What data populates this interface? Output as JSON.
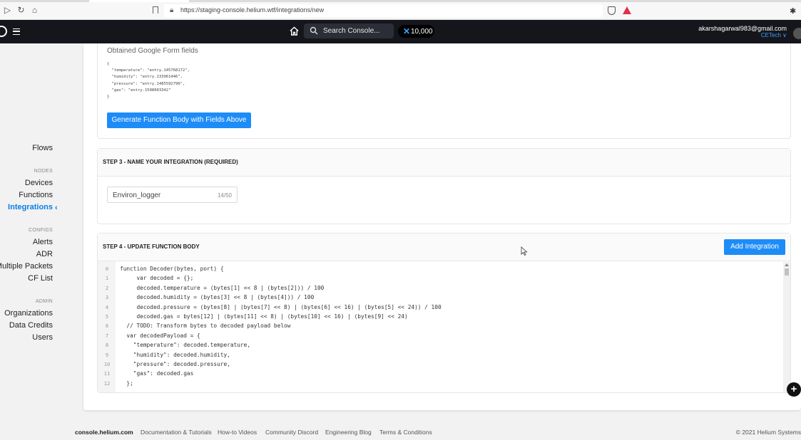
{
  "browser": {
    "url": "https://staging-console.helium.wtf/integrations/new"
  },
  "header": {
    "search_placeholder": "Search Console...",
    "dc_balance": "10,000",
    "user_email": "akarshagarwal983@gmail.com",
    "org_name": "CETech ∨"
  },
  "sidebar": {
    "flows": "Flows",
    "nodes_section": "NODES",
    "devices": "Devices",
    "functions": "Functions",
    "integrations": "Integrations",
    "configs_section": "CONFIGS",
    "alerts": "Alerts",
    "adr": "ADR",
    "multiple_packets": "Multiple Packets",
    "cf_list": "CF List",
    "admin_section": "ADMIN",
    "organizations": "Organizations",
    "data_credits": "Data Credits",
    "users": "Users"
  },
  "form_fields": {
    "title": "Obtained Google Form fields",
    "json": "{\n  \"temperature\": \"entry.145768172\",\n  \"humidity\": \"entry.133961446\",\n  \"pressure\": \"entry.1485592796\",\n  \"gas\": \"entry.1508003342\"\n}",
    "generate_button": "Generate Function Body with Fields Above"
  },
  "step3": {
    "title": "STEP 3 - NAME YOUR INTEGRATION (REQUIRED)",
    "name_value": "Environ_logger",
    "char_count": "14/50"
  },
  "step4": {
    "title": "STEP 4 - UPDATE FUNCTION BODY",
    "add_button": "Add Integration",
    "line_numbers": [
      "0",
      "1",
      "2",
      "3",
      "4",
      "5",
      "6",
      "7",
      "8",
      "9",
      "10",
      "11",
      "12"
    ],
    "code": [
      "function Decoder(bytes, port) {",
      "     var decoded = {};",
      "     decoded.temperature = (bytes[1] << 8 | (bytes[2])) / 100",
      "     decoded.humidity = (bytes[3] << 8 | (bytes[4])) / 100",
      "     decoded.pressure = (bytes[8] | (bytes[7] << 8) | (bytes[6] << 16) | (bytes[5] << 24)) / 100",
      "     decoded.gas = bytes[12] | (bytes[11] << 8) | (bytes[10] << 16) | (bytes[9] << 24)",
      "  // TODO: Transform bytes to decoded payload below",
      "  var decodedPayload = {",
      "    \"temperature\": decoded.temperature,",
      "    \"humidity\": decoded.humidity,",
      "    \"pressure\": decoded.pressure,",
      "    \"gas\": decoded.gas",
      "  };"
    ]
  },
  "footer": {
    "brand": "console.helium.com",
    "docs": "Documentation & Tutorials",
    "videos": "How-to Videos",
    "discord": "Community Discord",
    "blog": "Engineering Blog",
    "terms": "Terms & Conditions",
    "copyright": "© 2021 Helium Systems"
  },
  "colors": {
    "accent": "#1d8cf8",
    "header_bg": "#14161c",
    "active_nav": "#0a7fe6"
  }
}
